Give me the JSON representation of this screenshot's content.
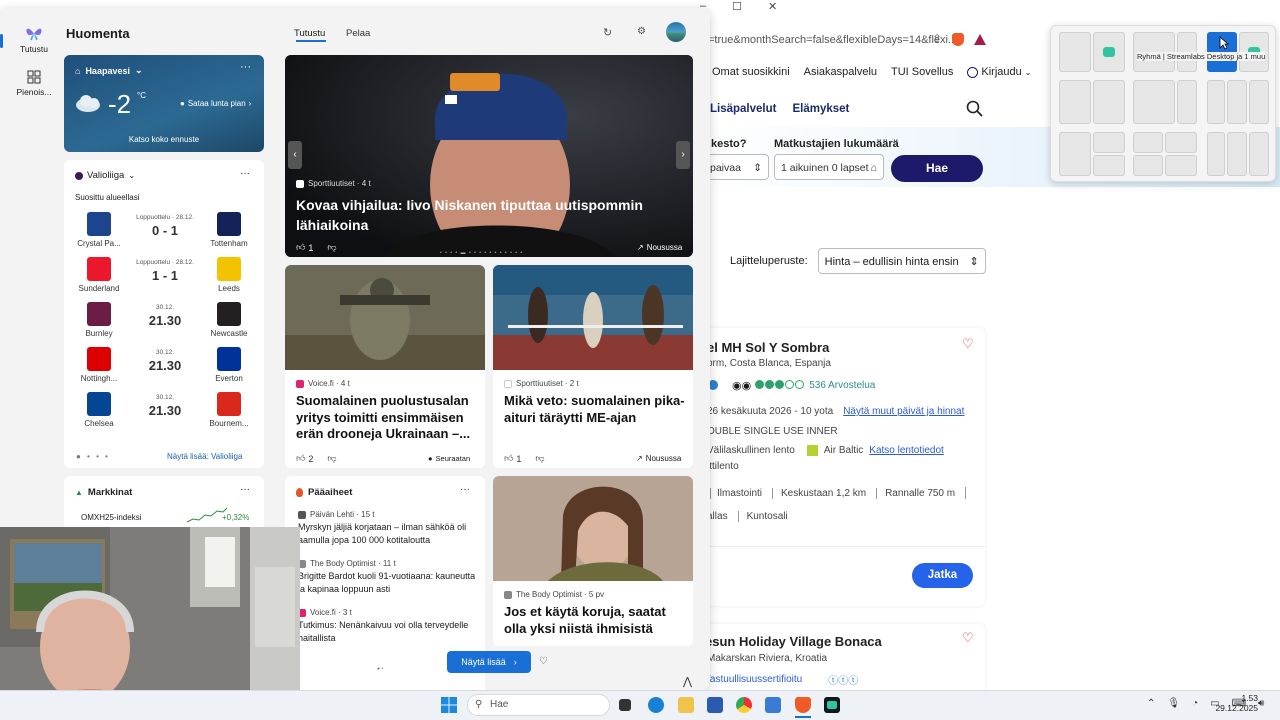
{
  "browser": {
    "url": "=true&monthSearch=false&flexibleDays=14&flexi...",
    "top_nav": [
      "Omat suosikkini",
      "Asiakaspalvelu",
      "TUI Sovellus",
      "Kirjaudu"
    ],
    "nav2": [
      "Lisäpalvelut",
      "Elämykset"
    ],
    "field1_label": "kesto?",
    "field1_value": "paivaa",
    "field2_label": "Matkustajien lukumäärä",
    "field2_value": "1 aikuinen 0 lapset",
    "search_button": "Hae",
    "sort_label": "Lajitteluperuste:",
    "sort_value": "Hinta – edullisin hinta ensin",
    "hotel1": {
      "name": "el MH Sol Y Sombra",
      "location": "orm, Costa Blanca, Espanja",
      "reviews": "536 Arvostelua",
      "dates": "26 kesäkuuta 2026 - 10 yota",
      "dates_link": "Näytä muut päivät ja hinnat",
      "room": "OUBLE SINGLE USE INNER",
      "flight": "Välilaskullinen lento",
      "airline": "Air Baltic",
      "flight_link": "Katso lentotiedot",
      "transfer": "ittilento",
      "features": [
        "Ilmastointi",
        "Keskustaan 1,2 km",
        "Rannalle 750 m"
      ],
      "features2": [
        "allas",
        "Kuntosali"
      ],
      "button": "Jatka"
    },
    "hotel2": {
      "name": "esun Holiday Village Bonaca",
      "location": "Makarskan Riviera, Kroatia",
      "badge": "Vastuullisuussertifioitu"
    }
  },
  "snap_tooltip": "Ryhmä | Streamlabs Desktop ja 1 muu",
  "widgets": {
    "sidebar": [
      {
        "label": "Tutustu"
      },
      {
        "label": "Pienois..."
      }
    ],
    "greeting": "Huomenta",
    "tabs": [
      "Tutustu",
      "Pelaa"
    ],
    "weather": {
      "location": "Haapavesi",
      "temp": "-2",
      "unit": "°C",
      "desc": "Sataa lunta pian",
      "link": "Katso koko ennuste"
    },
    "league": {
      "title": "Valioliiga",
      "subtitle": "Suosittu alueellasi",
      "more": "Näytä lisää: Valioliiga",
      "matches": [
        {
          "home": "Crystal Pa...",
          "away": "Tottenham",
          "status": "Loppuottelu · 28.12.",
          "score": "0 - 1",
          "home_color": "#1b458f",
          "away_color": "#132257"
        },
        {
          "home": "Sunderland",
          "away": "Leeds",
          "status": "Loppuottelu · 28.12.",
          "score": "1 - 1",
          "home_color": "#eb172b",
          "away_color": "#f3c300"
        },
        {
          "home": "Burnley",
          "away": "Newcastle",
          "status": "30.12.",
          "score": "21.30",
          "home_color": "#6c1d45",
          "away_color": "#241f20"
        },
        {
          "home": "Nottingh...",
          "away": "Everton",
          "status": "30.12.",
          "score": "21.30",
          "home_color": "#dd0000",
          "away_color": "#003399"
        },
        {
          "home": "Chelsea",
          "away": "Bournem...",
          "status": "30.12.",
          "score": "21.30",
          "home_color": "#034694",
          "away_color": "#da291c"
        }
      ]
    },
    "markets": {
      "title": "Markkinat",
      "index": "OMXH25-indeksi",
      "change": "+0,32%"
    },
    "hero": {
      "source": "Sporttiuutiset · 4 t",
      "title": "Kovaa vihjailua: Iivo Niskanen tiputtaa uutispommin lähiaikoina",
      "likes": "1",
      "trend": "Nousussa"
    },
    "news1": {
      "source": "Voice.fi · 4 t",
      "title": "Suomalainen puolustusalan yritys toimitti ensimmäisen erän drooneja Ukrainaan –...",
      "likes": "2",
      "follow": "Seuraatan"
    },
    "news2": {
      "source": "Sporttiuutiset · 2 t",
      "title": "Mikä veto: suomalainen pika-aituri täräytti ME-ajan",
      "likes": "1",
      "trend": "Nousussa"
    },
    "headlines": {
      "title": "Pääaiheet",
      "items": [
        {
          "source": "Päivän Lehti · 15 t",
          "title": "Myrskyn jäljiä korjataan – ilman sähköä oli aamulla jopa 100 000 kotitaloutta"
        },
        {
          "source": "The Body Optimist · 11 t",
          "title": "Brigitte Bardot kuoli 91-vuotiaana: kauneutta ja kapinaa loppuun asti"
        },
        {
          "source": "Voice.fi · 3 t",
          "title": "Tutkimus: Nenänkaivuu voi olla terveydelle haitallista"
        }
      ]
    },
    "news3": {
      "source": "The Body Optimist · 5 pv",
      "title": "Jos et käytä koruja, saatat olla yksi niistä ihmisistä"
    },
    "show_more": "Näytä lisää"
  },
  "taskbar": {
    "search": "Hae",
    "time": "1.53",
    "date": "29.12.2025"
  }
}
